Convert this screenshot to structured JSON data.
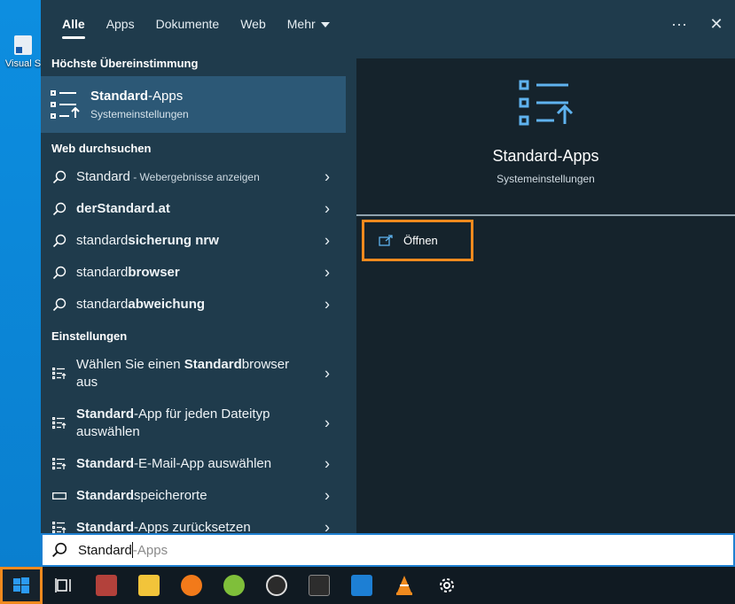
{
  "desktop": {
    "icon_label": "Visual S"
  },
  "tabs": [
    {
      "label": "Alle"
    },
    {
      "label": "Apps"
    },
    {
      "label": "Dokumente"
    },
    {
      "label": "Web"
    },
    {
      "label": "Mehr"
    }
  ],
  "top_actions": {
    "more": "···",
    "close": "✕"
  },
  "best_match": {
    "section": "Höchste Übereinstimmung",
    "title_bold": "Standard",
    "title_rest": "-Apps",
    "subtitle": "Systemeinstellungen"
  },
  "web": {
    "section": "Web durchsuchen",
    "items": [
      {
        "pre": "Standard",
        "bold": "",
        "sub": " - Webergebnisse anzeigen"
      },
      {
        "pre": "",
        "bold": "derStandard.at",
        "sub": ""
      },
      {
        "pre": "standard",
        "bold": "sicherung nrw",
        "sub": ""
      },
      {
        "pre": "standard",
        "bold": "browser",
        "sub": ""
      },
      {
        "pre": "standard",
        "bold": "abweichung",
        "sub": ""
      }
    ]
  },
  "settings": {
    "section": "Einstellungen",
    "items": [
      {
        "pre": "Wählen Sie einen ",
        "bold": "Standard",
        "post": "browser aus"
      },
      {
        "pre": "",
        "bold": "Standard",
        "post": "-App für jeden Dateityp auswählen"
      },
      {
        "pre": "",
        "bold": "Standard",
        "post": "-E-Mail-App auswählen"
      },
      {
        "pre": "",
        "bold": "Standard",
        "post": "speicherorte"
      },
      {
        "pre": "",
        "bold": "Standard",
        "post": "-Apps zurücksetzen"
      }
    ]
  },
  "preview": {
    "title": "Standard-Apps",
    "subtitle": "Systemeinstellungen",
    "open_label": "Öffnen"
  },
  "search": {
    "typed": "Standard",
    "suggestion": "-Apps"
  },
  "taskbar": {
    "items": [
      {
        "name": "task-view-icon",
        "color": "#101a22"
      },
      {
        "name": "app-red-icon",
        "color": "#b3413b"
      },
      {
        "name": "file-explorer-icon",
        "color": "#f2c43a"
      },
      {
        "name": "firefox-icon",
        "color": "#f27a1a"
      },
      {
        "name": "green-app-icon",
        "color": "#7fbf3a"
      },
      {
        "name": "obs-icon",
        "color": "#2b2b2b"
      },
      {
        "name": "terminal-icon",
        "color": "#2d2d2d"
      },
      {
        "name": "photos-icon",
        "color": "#1d7fd4"
      },
      {
        "name": "vlc-icon",
        "color": "#f08a1e"
      },
      {
        "name": "settings-gear-icon",
        "color": "#101a22"
      }
    ]
  },
  "colors": {
    "accent": "#f08a1e",
    "panel": "#1f3b4c",
    "selected": "#2c5876",
    "preview": "#15232c"
  }
}
